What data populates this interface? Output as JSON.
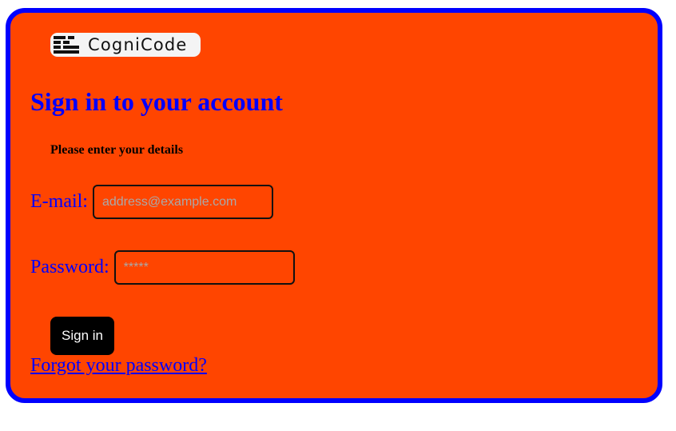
{
  "brand": {
    "name": "CogniCode",
    "logo_icon": "stacked-bars-logo-icon"
  },
  "form": {
    "title": "Sign in to your account",
    "subtitle": "Please enter your details",
    "email": {
      "label": "E-mail:",
      "placeholder": "address@example.com",
      "value": ""
    },
    "password": {
      "label": "Password:",
      "placeholder": "*****",
      "value": ""
    },
    "submit_label": "Sign in",
    "forgot_label": "Forgot your password?"
  },
  "colors": {
    "card_background": "#ff4500",
    "card_border": "#0000ff",
    "heading": "#0000ff",
    "button_background": "#000000",
    "button_text": "#ffffff"
  }
}
